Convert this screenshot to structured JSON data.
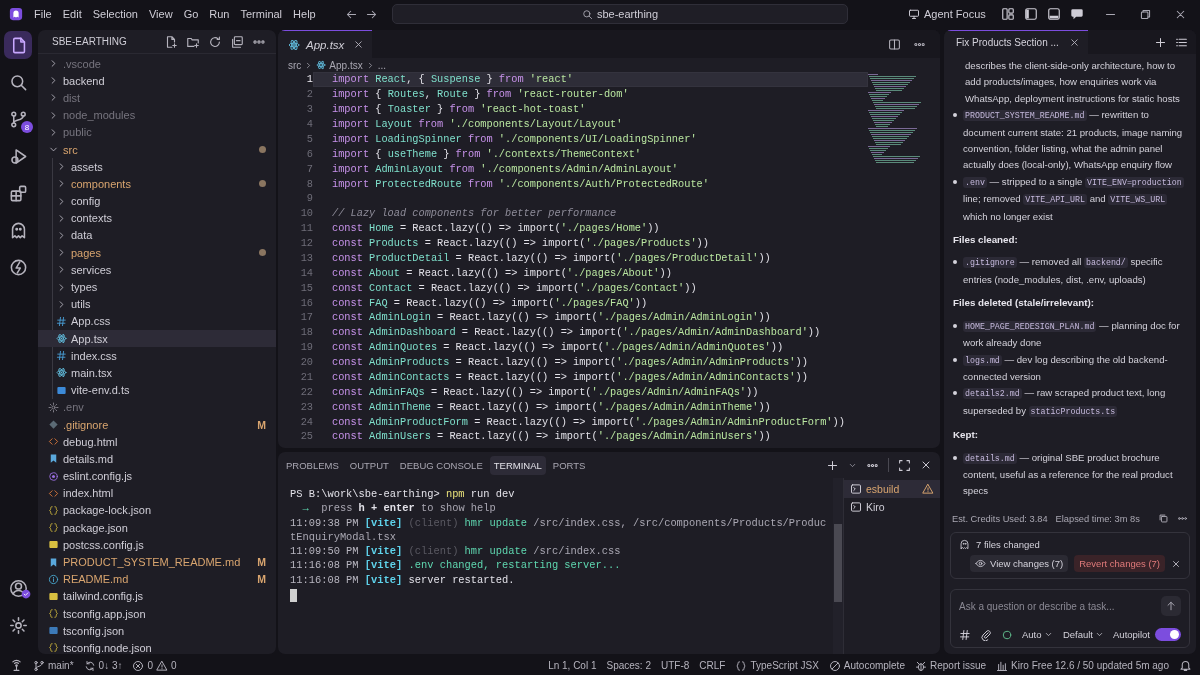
{
  "menu": [
    "File",
    "Edit",
    "Selection",
    "View",
    "Go",
    "Run",
    "Terminal",
    "Help"
  ],
  "command_center": {
    "label": "sbe-earthing"
  },
  "agent_focus": "Agent Focus",
  "activity_bar": {
    "items": [
      {
        "kind": "explorer",
        "selected": true
      },
      {
        "kind": "search",
        "selected": false
      },
      {
        "kind": "source_control",
        "selected": false,
        "badge": "8"
      },
      {
        "kind": "run_debug",
        "selected": false
      },
      {
        "kind": "extensions",
        "selected": false
      },
      {
        "kind": "agent",
        "selected": false
      },
      {
        "kind": "powers",
        "selected": false
      }
    ],
    "bottom_items": [
      {
        "kind": "account"
      },
      {
        "kind": "settings"
      }
    ]
  },
  "explorer": {
    "title": "SBE-EARTHING",
    "items": [
      {
        "name": ".vscode",
        "kind": "folder",
        "dimmed": true,
        "modified": false,
        "expanded": false,
        "selected": false
      },
      {
        "name": "backend",
        "kind": "folder",
        "dimmed": false,
        "modified": false,
        "expanded": false,
        "selected": false
      },
      {
        "name": "dist",
        "kind": "folder",
        "dimmed": true,
        "modified": false,
        "expanded": false,
        "selected": false
      },
      {
        "name": "node_modules",
        "kind": "folder",
        "dimmed": true,
        "modified": false,
        "expanded": false,
        "selected": false
      },
      {
        "name": "public",
        "kind": "folder",
        "dimmed": true,
        "modified": false,
        "expanded": false,
        "selected": false
      },
      {
        "name": "src",
        "kind": "folder",
        "dimmed": false,
        "modified": true,
        "expanded": true,
        "selected": false,
        "children": [
          {
            "name": "assets",
            "kind": "folder",
            "dimmed": false,
            "modified": false,
            "expanded": false,
            "selected": false
          },
          {
            "name": "components",
            "kind": "folder",
            "dimmed": false,
            "modified": true,
            "expanded": false,
            "selected": false
          },
          {
            "name": "config",
            "kind": "folder",
            "dimmed": false,
            "modified": false,
            "expanded": false,
            "selected": false
          },
          {
            "name": "contexts",
            "kind": "folder",
            "dimmed": false,
            "modified": false,
            "expanded": false,
            "selected": false
          },
          {
            "name": "data",
            "kind": "folder",
            "dimmed": false,
            "modified": false,
            "expanded": false,
            "selected": false
          },
          {
            "name": "pages",
            "kind": "folder",
            "dimmed": false,
            "modified": true,
            "expanded": false,
            "selected": false
          },
          {
            "name": "services",
            "kind": "folder",
            "dimmed": false,
            "modified": false,
            "expanded": false,
            "selected": false
          },
          {
            "name": "types",
            "kind": "folder",
            "dimmed": false,
            "modified": false,
            "expanded": false,
            "selected": false
          },
          {
            "name": "utils",
            "kind": "folder",
            "dimmed": false,
            "modified": false,
            "expanded": false,
            "selected": false
          },
          {
            "name": "App.css",
            "kind": "css",
            "dimmed": false,
            "modified": false,
            "selected": false
          },
          {
            "name": "App.tsx",
            "kind": "react",
            "dimmed": false,
            "modified": false,
            "selected": true
          },
          {
            "name": "index.css",
            "kind": "css",
            "dimmed": false,
            "modified": false,
            "selected": false
          },
          {
            "name": "main.tsx",
            "kind": "react",
            "dimmed": false,
            "modified": false,
            "selected": false
          },
          {
            "name": "vite-env.d.ts",
            "kind": "ts",
            "dimmed": false,
            "modified": false,
            "selected": false
          }
        ]
      },
      {
        "name": ".env",
        "kind": "env",
        "dimmed": true,
        "modified": false,
        "selected": false
      },
      {
        "name": ".gitignore",
        "kind": "git",
        "dimmed": false,
        "modified": true,
        "badge": "M",
        "selected": false
      },
      {
        "name": "debug.html",
        "kind": "html",
        "dimmed": false,
        "modified": false,
        "selected": false
      },
      {
        "name": "details.md",
        "kind": "markdown",
        "dimmed": false,
        "modified": false,
        "selected": false
      },
      {
        "name": "eslint.config.js",
        "kind": "eslint",
        "dimmed": false,
        "modified": false,
        "selected": false
      },
      {
        "name": "index.html",
        "kind": "html",
        "dimmed": false,
        "modified": false,
        "selected": false
      },
      {
        "name": "package-lock.json",
        "kind": "json",
        "dimmed": false,
        "modified": false,
        "selected": false
      },
      {
        "name": "package.json",
        "kind": "json",
        "dimmed": false,
        "modified": false,
        "selected": false
      },
      {
        "name": "postcss.config.js",
        "kind": "js",
        "dimmed": false,
        "modified": false,
        "selected": false
      },
      {
        "name": "PRODUCT_SYSTEM_README.md",
        "kind": "markdown",
        "dimmed": false,
        "modified": true,
        "badge": "M",
        "selected": false
      },
      {
        "name": "README.md",
        "kind": "readme",
        "dimmed": false,
        "modified": true,
        "badge": "M",
        "selected": false
      },
      {
        "name": "tailwind.config.js",
        "kind": "js",
        "dimmed": false,
        "modified": false,
        "selected": false
      },
      {
        "name": "tsconfig.app.json",
        "kind": "json",
        "dimmed": false,
        "modified": false,
        "selected": false
      },
      {
        "name": "tsconfig.json",
        "kind": "tsconfig",
        "dimmed": false,
        "modified": false,
        "selected": false
      },
      {
        "name": "tsconfig.node.json",
        "kind": "json",
        "dimmed": false,
        "modified": false,
        "selected": false
      }
    ]
  },
  "editor": {
    "tab": {
      "label": "App.tsx",
      "selected": true
    },
    "breadcrumb": [
      "src",
      "App.tsx",
      "..."
    ],
    "lines": [
      {
        "number": "1",
        "current": true,
        "segments": [
          {
            "kind": "kw",
            "t": "import"
          },
          {
            "kind": "id",
            "t": " React"
          },
          {
            "kind": "p",
            "t": ", { "
          },
          {
            "kind": "id",
            "t": "Suspense"
          },
          {
            "kind": "p",
            "t": " } "
          },
          {
            "kind": "kw",
            "t": "from"
          },
          {
            "kind": "str",
            "t": " 'react'"
          }
        ]
      },
      {
        "number": "2",
        "current": false,
        "segments": [
          {
            "kind": "kw",
            "t": "import"
          },
          {
            "kind": "p",
            "t": " { "
          },
          {
            "kind": "id",
            "t": "Routes"
          },
          {
            "kind": "p",
            "t": ", "
          },
          {
            "kind": "id",
            "t": "Route"
          },
          {
            "kind": "p",
            "t": " } "
          },
          {
            "kind": "kw",
            "t": "from"
          },
          {
            "kind": "str",
            "t": " 'react-router-dom'"
          }
        ]
      },
      {
        "number": "3",
        "current": false,
        "segments": [
          {
            "kind": "kw",
            "t": "import"
          },
          {
            "kind": "p",
            "t": " { "
          },
          {
            "kind": "id",
            "t": "Toaster"
          },
          {
            "kind": "p",
            "t": " } "
          },
          {
            "kind": "kw",
            "t": "from"
          },
          {
            "kind": "str",
            "t": " 'react-hot-toast'"
          }
        ]
      },
      {
        "number": "4",
        "current": false,
        "segments": [
          {
            "kind": "kw",
            "t": "import"
          },
          {
            "kind": "id",
            "t": " Layout "
          },
          {
            "kind": "kw",
            "t": "from"
          },
          {
            "kind": "str",
            "t": " './components/Layout/Layout'"
          }
        ]
      },
      {
        "number": "5",
        "current": false,
        "segments": [
          {
            "kind": "kw",
            "t": "import"
          },
          {
            "kind": "id",
            "t": " LoadingSpinner "
          },
          {
            "kind": "kw",
            "t": "from"
          },
          {
            "kind": "str",
            "t": " './components/UI/LoadingSpinner'"
          }
        ]
      },
      {
        "number": "6",
        "current": false,
        "segments": [
          {
            "kind": "kw",
            "t": "import"
          },
          {
            "kind": "p",
            "t": " { "
          },
          {
            "kind": "id",
            "t": "useTheme"
          },
          {
            "kind": "p",
            "t": " } "
          },
          {
            "kind": "kw",
            "t": "from"
          },
          {
            "kind": "str",
            "t": " './contexts/ThemeContext'"
          }
        ]
      },
      {
        "number": "7",
        "current": false,
        "segments": [
          {
            "kind": "kw",
            "t": "import"
          },
          {
            "kind": "id",
            "t": " AdminLayout "
          },
          {
            "kind": "kw",
            "t": "from"
          },
          {
            "kind": "str",
            "t": " './components/Admin/AdminLayout'"
          }
        ]
      },
      {
        "number": "8",
        "current": false,
        "segments": [
          {
            "kind": "kw",
            "t": "import"
          },
          {
            "kind": "id",
            "t": " ProtectedRoute "
          },
          {
            "kind": "kw",
            "t": "from"
          },
          {
            "kind": "str",
            "t": " './components/Auth/ProtectedRoute'"
          }
        ]
      },
      {
        "number": "9",
        "current": false
      },
      {
        "number": "10",
        "current": false,
        "segments": [
          {
            "kind": "cm",
            "t": "// Lazy load components for better performance"
          }
        ]
      },
      {
        "number": "11",
        "current": false,
        "segments": [
          {
            "kind": "kw",
            "t": "const"
          },
          {
            "kind": "id",
            "t": " Home"
          },
          {
            "kind": "p",
            "t": " = React.lazy(() => import("
          },
          {
            "kind": "str",
            "t": "'./pages/Home'"
          },
          {
            "kind": "p",
            "t": "))"
          }
        ]
      },
      {
        "number": "12",
        "current": false,
        "segments": [
          {
            "kind": "kw",
            "t": "const"
          },
          {
            "kind": "id",
            "t": " Products"
          },
          {
            "kind": "p",
            "t": " = React.lazy(() => import("
          },
          {
            "kind": "str",
            "t": "'./pages/Products'"
          },
          {
            "kind": "p",
            "t": "))"
          }
        ]
      },
      {
        "number": "13",
        "current": false,
        "segments": [
          {
            "kind": "kw",
            "t": "const"
          },
          {
            "kind": "id",
            "t": " ProductDetail"
          },
          {
            "kind": "p",
            "t": " = React.lazy(() => import("
          },
          {
            "kind": "str",
            "t": "'./pages/ProductDetail'"
          },
          {
            "kind": "p",
            "t": "))"
          }
        ]
      },
      {
        "number": "14",
        "current": false,
        "segments": [
          {
            "kind": "kw",
            "t": "const"
          },
          {
            "kind": "id",
            "t": " About"
          },
          {
            "kind": "p",
            "t": " = React.lazy(() => import("
          },
          {
            "kind": "str",
            "t": "'./pages/About'"
          },
          {
            "kind": "p",
            "t": "))"
          }
        ]
      },
      {
        "number": "15",
        "current": false,
        "segments": [
          {
            "kind": "kw",
            "t": "const"
          },
          {
            "kind": "id",
            "t": " Contact"
          },
          {
            "kind": "p",
            "t": " = React.lazy(() => import("
          },
          {
            "kind": "str",
            "t": "'./pages/Contact'"
          },
          {
            "kind": "p",
            "t": "))"
          }
        ]
      },
      {
        "number": "16",
        "current": false,
        "segments": [
          {
            "kind": "kw",
            "t": "const"
          },
          {
            "kind": "id",
            "t": " FAQ"
          },
          {
            "kind": "p",
            "t": " = React.lazy(() => import("
          },
          {
            "kind": "str",
            "t": "'./pages/FAQ'"
          },
          {
            "kind": "p",
            "t": "))"
          }
        ]
      },
      {
        "number": "17",
        "current": false,
        "segments": [
          {
            "kind": "kw",
            "t": "const"
          },
          {
            "kind": "id",
            "t": " AdminLogin"
          },
          {
            "kind": "p",
            "t": " = React.lazy(() => import("
          },
          {
            "kind": "str",
            "t": "'./pages/Admin/AdminLogin'"
          },
          {
            "kind": "p",
            "t": "))"
          }
        ]
      },
      {
        "number": "18",
        "current": false,
        "segments": [
          {
            "kind": "kw",
            "t": "const"
          },
          {
            "kind": "id",
            "t": " AdminDashboard"
          },
          {
            "kind": "p",
            "t": " = React.lazy(() => import("
          },
          {
            "kind": "str",
            "t": "'./pages/Admin/AdminDashboard'"
          },
          {
            "kind": "p",
            "t": "))"
          }
        ]
      },
      {
        "number": "19",
        "current": false,
        "segments": [
          {
            "kind": "kw",
            "t": "const"
          },
          {
            "kind": "id",
            "t": " AdminQuotes"
          },
          {
            "kind": "p",
            "t": " = React.lazy(() => import("
          },
          {
            "kind": "str",
            "t": "'./pages/Admin/AdminQuotes'"
          },
          {
            "kind": "p",
            "t": "))"
          }
        ]
      },
      {
        "number": "20",
        "current": false,
        "segments": [
          {
            "kind": "kw",
            "t": "const"
          },
          {
            "kind": "id",
            "t": " AdminProducts"
          },
          {
            "kind": "p",
            "t": " = React.lazy(() => import("
          },
          {
            "kind": "str",
            "t": "'./pages/Admin/AdminProducts'"
          },
          {
            "kind": "p",
            "t": "))"
          }
        ]
      },
      {
        "number": "21",
        "current": false,
        "segments": [
          {
            "kind": "kw",
            "t": "const"
          },
          {
            "kind": "id",
            "t": " AdminContacts"
          },
          {
            "kind": "p",
            "t": " = React.lazy(() => import("
          },
          {
            "kind": "str",
            "t": "'./pages/Admin/AdminContacts'"
          },
          {
            "kind": "p",
            "t": "))"
          }
        ]
      },
      {
        "number": "22",
        "current": false,
        "segments": [
          {
            "kind": "kw",
            "t": "const"
          },
          {
            "kind": "id",
            "t": " AdminFAQs"
          },
          {
            "kind": "p",
            "t": " = React.lazy(() => import("
          },
          {
            "kind": "str",
            "t": "'./pages/Admin/AdminFAQs'"
          },
          {
            "kind": "p",
            "t": "))"
          }
        ]
      },
      {
        "number": "23",
        "current": false,
        "segments": [
          {
            "kind": "kw",
            "t": "const"
          },
          {
            "kind": "id",
            "t": " AdminTheme"
          },
          {
            "kind": "p",
            "t": " = React.lazy(() => import("
          },
          {
            "kind": "str",
            "t": "'./pages/Admin/AdminTheme'"
          },
          {
            "kind": "p",
            "t": "))"
          }
        ]
      },
      {
        "number": "24",
        "current": false,
        "segments": [
          {
            "kind": "kw",
            "t": "const"
          },
          {
            "kind": "id",
            "t": " AdminProductForm"
          },
          {
            "kind": "p",
            "t": " = React.lazy(() => import("
          },
          {
            "kind": "str",
            "t": "'./pages/Admin/AdminProductForm'"
          },
          {
            "kind": "p",
            "t": "))"
          }
        ]
      },
      {
        "number": "25",
        "current": false,
        "segments": [
          {
            "kind": "kw",
            "t": "const"
          },
          {
            "kind": "id",
            "t": " AdminUsers"
          },
          {
            "kind": "p",
            "t": " = React.lazy(() => import("
          },
          {
            "kind": "str",
            "t": "'./pages/Admin/AdminUsers'"
          },
          {
            "kind": "p",
            "t": "))"
          }
        ]
      }
    ]
  },
  "panel": {
    "tabs": [
      {
        "label": "PROBLEMS",
        "selected": false
      },
      {
        "label": "OUTPUT",
        "selected": false
      },
      {
        "label": "DEBUG CONSOLE",
        "selected": false
      },
      {
        "label": "TERMINAL",
        "selected": true
      },
      {
        "label": "PORTS",
        "selected": false
      }
    ],
    "terminal_lines": [
      [
        {
          "kind": "text",
          "t": "PS B:\\work\\sbe-earthing> "
        },
        {
          "kind": "cmd",
          "t": "npm"
        },
        {
          "kind": "text",
          "t": " run dev"
        }
      ],
      [
        {
          "kind": "green",
          "t": "  → "
        },
        {
          "kind": "dim",
          "t": " press "
        },
        {
          "kind": "bold",
          "t": "h + enter"
        },
        {
          "kind": "dim",
          "t": " to show help"
        }
      ],
      [
        {
          "kind": "time",
          "t": "11:09:38 PM "
        },
        {
          "kind": "tag",
          "t": "[vite]"
        },
        {
          "kind": "faint",
          "t": " (client) "
        },
        {
          "kind": "green",
          "t": "hmr update "
        },
        {
          "kind": "dim",
          "t": "/src/index.css, /src/components/Products/Produc"
        }
      ],
      [
        {
          "kind": "dim",
          "t": "tEnquiryModal.tsx"
        }
      ],
      [
        {
          "kind": "time",
          "t": "11:09:50 PM "
        },
        {
          "kind": "tag",
          "t": "[vite]"
        },
        {
          "kind": "faint",
          "t": " (client) "
        },
        {
          "kind": "green",
          "t": "hmr update "
        },
        {
          "kind": "dim",
          "t": "/src/index.css"
        }
      ],
      [
        {
          "kind": "time",
          "t": "11:16:08 PM "
        },
        {
          "kind": "tag",
          "t": "[vite]"
        },
        {
          "kind": "green",
          "t": " .env changed, restarting server..."
        }
      ],
      [
        {
          "kind": "time",
          "t": "11:16:08 PM "
        },
        {
          "kind": "tag",
          "t": "[vite]"
        },
        {
          "kind": "text",
          "t": " server restarted."
        }
      ]
    ],
    "terminals": [
      {
        "label": "esbuild",
        "warning": true,
        "selected": true
      },
      {
        "label": "Kiro",
        "warning": false,
        "selected": false
      }
    ]
  },
  "chat": {
    "tab": {
      "label": "Fix Products Section ...",
      "selected": true
    },
    "blocks": [
      {
        "kind": "continuation",
        "segments": [
          {
            "kind": "text",
            "t": "describes the client-side-only architecture, how to add products/images, how enquiries work via WhatsApp, deployment instructions for static hosts"
          }
        ]
      },
      {
        "kind": "bullet",
        "segments": [
          {
            "kind": "code",
            "t": "PRODUCT_SYSTEM_README.md"
          },
          {
            "kind": "text",
            "t": " — rewritten to document current state: 21 products, image naming convention, folder listing, what the admin panel actually does (local-only), WhatsApp enquiry flow"
          }
        ]
      },
      {
        "kind": "bullet",
        "segments": [
          {
            "kind": "code",
            "t": ".env"
          },
          {
            "kind": "text",
            "t": " — stripped to a single "
          },
          {
            "kind": "code",
            "t": "VITE_ENV=production"
          },
          {
            "kind": "text",
            "t": " line; removed "
          },
          {
            "kind": "code",
            "t": "VITE_API_URL"
          },
          {
            "kind": "text",
            "t": " and "
          },
          {
            "kind": "code",
            "t": "VITE_WS_URL"
          },
          {
            "kind": "text",
            "t": " which no longer exist"
          }
        ]
      },
      {
        "kind": "heading",
        "segments": [
          {
            "kind": "text",
            "t": "Files cleaned:"
          }
        ]
      },
      {
        "kind": "bullet",
        "segments": [
          {
            "kind": "code",
            "t": ".gitignore"
          },
          {
            "kind": "text",
            "t": " — removed all "
          },
          {
            "kind": "code",
            "t": "backend/"
          },
          {
            "kind": "text",
            "t": " specific entries (node_modules, dist, .env, uploads)"
          }
        ]
      },
      {
        "kind": "heading",
        "segments": [
          {
            "kind": "text",
            "t": "Files deleted (stale/irrelevant):"
          }
        ]
      },
      {
        "kind": "bullet",
        "segments": [
          {
            "kind": "code",
            "t": "HOME_PAGE_REDESIGN_PLAN.md"
          },
          {
            "kind": "text",
            "t": " — planning doc for work already done"
          }
        ]
      },
      {
        "kind": "bullet",
        "segments": [
          {
            "kind": "code",
            "t": "logs.md"
          },
          {
            "kind": "text",
            "t": " — dev log describing the old backend-connected version"
          }
        ]
      },
      {
        "kind": "bullet",
        "segments": [
          {
            "kind": "code",
            "t": "details2.md"
          },
          {
            "kind": "text",
            "t": " — raw scraped product text, long superseded by "
          },
          {
            "kind": "code",
            "t": "staticProducts.ts"
          }
        ]
      },
      {
        "kind": "heading",
        "segments": [
          {
            "kind": "text",
            "t": "Kept:"
          }
        ]
      },
      {
        "kind": "bullet",
        "segments": [
          {
            "kind": "code",
            "t": "details.md"
          },
          {
            "kind": "text",
            "t": " — original SBE product brochure content, useful as a reference for the real product specs"
          }
        ]
      }
    ],
    "credits": "Est. Credits Used: 3.84",
    "elapsed": "Elapsed time: 3m 8s",
    "changes": {
      "summary": "7 files changed",
      "view": "View changes (7)",
      "revert": "Revert changes (7)"
    },
    "input": {
      "placeholder": "Ask a question or describe a task..."
    },
    "model": "Auto",
    "mode": "Default",
    "autopilot": {
      "label": "Autopilot",
      "on": true
    }
  },
  "status_bar": {
    "branch": "main*",
    "sync": "0↓ 3↑",
    "errors": "0",
    "warnings": "0",
    "position": "Ln 1, Col 1",
    "indent": "Spaces: 2",
    "encoding": "UTF-8",
    "eol": "CRLF",
    "language": "TypeScript JSX",
    "autocomplete": "Autocomplete",
    "report": "Report issue",
    "plan": "Kiro Free 12.6 / 50 updated 5m ago"
  }
}
